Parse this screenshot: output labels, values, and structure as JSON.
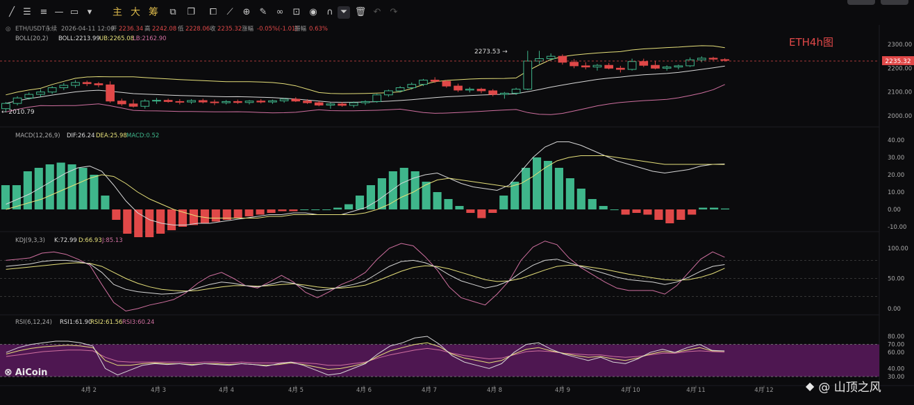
{
  "toolbar": {
    "icons": [
      "trendline-icon",
      "parallel-lines-icon",
      "horizontal-lines-icon",
      "horizontal-line-icon",
      "rectangle-icon"
    ],
    "labels": [
      "主",
      "大",
      "筹"
    ],
    "icons2": [
      "crop-icon",
      "copy-icon",
      "search-plus-icon",
      "ruler-icon",
      "magic-icon",
      "link-icon",
      "lock-icon",
      "magnet-icon",
      "filter-icon",
      "trash-icon",
      "undo-icon",
      "redo-icon"
    ]
  },
  "main_header": {
    "symbol": "ETH/USDT永续",
    "datetime": "2026-04-11 12:00",
    "open_label": "开",
    "open": "2236.34",
    "high_label": "高",
    "high": "2242.08",
    "low_label": "低",
    "low": "2228.06",
    "close_label": "收",
    "close": "2235.32",
    "change_label": "涨幅",
    "change": "-0.05%(-1.01)",
    "amp_label": "振幅",
    "amp": "0.63%"
  },
  "boll_header": {
    "name": "BOLL(20,2)",
    "boll": "BOLL:2213.99",
    "ub": "UB:2265.08",
    "lb": "LB:2162.90"
  },
  "macd_header": {
    "name": "MACD(12,26,9)",
    "dif": "DIF:26.24",
    "dea": "DEA:25.98",
    "macd": "MACD:0.52"
  },
  "kdj_header": {
    "name": "KDJ(9,3,3)",
    "k": "K:72.99",
    "d": "D:66.93",
    "j": "J:85.13"
  },
  "rsi_header": {
    "name": "RSI(6,12,24)",
    "r1": "RSI1:61.90",
    "r2": "RSI2:61.56",
    "r3": "RSI3:60.24"
  },
  "chart_label": "ETH4h图",
  "price_marks": {
    "high_mark": "2273.53",
    "low_mark": "2010.79",
    "last_price": "2235.32"
  },
  "branding": {
    "aicoin": "AiCoin",
    "watermark": "@ 山顶之风"
  },
  "colors": {
    "up": "#3fb68b",
    "down": "#e04848",
    "boll_mid": "#d8d8d8",
    "boll_up": "#e6e07a",
    "boll_low": "#d070a0",
    "rsi_band": "#5a1a5e"
  },
  "chart_data": {
    "type": "candlestick",
    "x_axis": {
      "ticks": [
        "4月 2",
        "4月 3",
        "4月 4",
        "4月 5",
        "4月 6",
        "4月 7",
        "4月 8",
        "4月 9",
        "4月 10",
        "4月 11",
        "4月 12"
      ]
    },
    "price_axis": {
      "ticks": [
        2300,
        2200,
        2100,
        2000
      ],
      "labels": [
        "2300.00",
        "2200.00",
        "2100.00",
        "2000.00"
      ]
    },
    "candles": [
      [
        2030,
        2058,
        2015,
        2052
      ],
      [
        2052,
        2082,
        2044,
        2075
      ],
      [
        2075,
        2098,
        2068,
        2090
      ],
      [
        2090,
        2112,
        2080,
        2100
      ],
      [
        2100,
        2125,
        2092,
        2118
      ],
      [
        2118,
        2138,
        2108,
        2128
      ],
      [
        2128,
        2150,
        2118,
        2140
      ],
      [
        2140,
        2148,
        2125,
        2135
      ],
      [
        2135,
        2142,
        2120,
        2130
      ],
      [
        2130,
        2145,
        2055,
        2062
      ],
      [
        2062,
        2072,
        2042,
        2050
      ],
      [
        2050,
        2068,
        2035,
        2040
      ],
      [
        2040,
        2070,
        2030,
        2062
      ],
      [
        2062,
        2075,
        2050,
        2065
      ],
      [
        2065,
        2072,
        2055,
        2060
      ],
      [
        2060,
        2070,
        2048,
        2058
      ],
      [
        2058,
        2070,
        2050,
        2064
      ],
      [
        2064,
        2072,
        2052,
        2058
      ],
      [
        2058,
        2068,
        2045,
        2055
      ],
      [
        2055,
        2066,
        2048,
        2060
      ],
      [
        2060,
        2068,
        2050,
        2056
      ],
      [
        2056,
        2066,
        2048,
        2062
      ],
      [
        2062,
        2070,
        2052,
        2058
      ],
      [
        2058,
        2068,
        2050,
        2063
      ],
      [
        2063,
        2075,
        2055,
        2070
      ],
      [
        2070,
        2078,
        2058,
        2062
      ],
      [
        2062,
        2070,
        2050,
        2055
      ],
      [
        2055,
        2062,
        2040,
        2045
      ],
      [
        2045,
        2055,
        2030,
        2050
      ],
      [
        2050,
        2058,
        2038,
        2044
      ],
      [
        2044,
        2060,
        2035,
        2055
      ],
      [
        2055,
        2065,
        2045,
        2060
      ],
      [
        2060,
        2092,
        2055,
        2088
      ],
      [
        2088,
        2110,
        2080,
        2105
      ],
      [
        2105,
        2125,
        2098,
        2118
      ],
      [
        2118,
        2140,
        2110,
        2132
      ],
      [
        2132,
        2155,
        2125,
        2150
      ],
      [
        2150,
        2162,
        2138,
        2145
      ],
      [
        2145,
        2150,
        2118,
        2125
      ],
      [
        2125,
        2135,
        2100,
        2108
      ],
      [
        2108,
        2120,
        2098,
        2112
      ],
      [
        2112,
        2118,
        2095,
        2105
      ],
      [
        2105,
        2112,
        2082,
        2090
      ],
      [
        2090,
        2100,
        2072,
        2095
      ],
      [
        2095,
        2118,
        2088,
        2112
      ],
      [
        2112,
        2273,
        2108,
        2230
      ],
      [
        2230,
        2273,
        2218,
        2240
      ],
      [
        2240,
        2262,
        2230,
        2250
      ],
      [
        2250,
        2258,
        2215,
        2225
      ],
      [
        2225,
        2238,
        2200,
        2210
      ],
      [
        2210,
        2225,
        2195,
        2205
      ],
      [
        2205,
        2218,
        2190,
        2212
      ],
      [
        2212,
        2222,
        2195,
        2200
      ],
      [
        2200,
        2210,
        2182,
        2195
      ],
      [
        2195,
        2240,
        2190,
        2228
      ],
      [
        2228,
        2240,
        2205,
        2212
      ],
      [
        2212,
        2230,
        2195,
        2200
      ],
      [
        2200,
        2212,
        2190,
        2205
      ],
      [
        2205,
        2215,
        2195,
        2210
      ],
      [
        2210,
        2245,
        2205,
        2235
      ],
      [
        2235,
        2250,
        2225,
        2242
      ],
      [
        2242,
        2248,
        2232,
        2238
      ],
      [
        2236,
        2242,
        2228,
        2235
      ]
    ],
    "boll": {
      "mid_last": 2213.99,
      "ub_last": 2265.08,
      "lb_last": 2162.9
    },
    "macd_axis": {
      "ticks": [
        40,
        30,
        20,
        10,
        0,
        -10
      ],
      "labels": [
        "40.00",
        "30.00",
        "20.00",
        "10.00",
        "0.00",
        "-10.00"
      ]
    },
    "macd_hist": [
      14,
      14,
      22,
      24,
      26,
      27,
      26,
      24,
      20,
      8,
      -6,
      -14,
      -16,
      -16,
      -14,
      -12,
      -10,
      -9,
      -8,
      -7,
      -6,
      -5,
      -4,
      -3,
      -2,
      -1,
      -1,
      0,
      0,
      0,
      1,
      3,
      8,
      14,
      18,
      22,
      24,
      22,
      16,
      10,
      6,
      2,
      -2,
      -5,
      -2,
      8,
      16,
      24,
      30,
      28,
      24,
      18,
      12,
      6,
      2,
      0,
      -3,
      -2,
      -3,
      -6,
      -8,
      -6,
      -3,
      1,
      1,
      0.52
    ],
    "macd_dif": [
      3,
      6,
      9,
      13,
      17,
      21,
      24,
      25,
      22,
      14,
      5,
      -2,
      -6,
      -8,
      -9,
      -9,
      -8,
      -8,
      -7,
      -6,
      -5,
      -4,
      -3,
      -3,
      -2,
      -2,
      -3,
      -3,
      -3,
      -1,
      1,
      5,
      10,
      15,
      18,
      20,
      21,
      18,
      15,
      13,
      12,
      11,
      14,
      22,
      30,
      36,
      39,
      39,
      37,
      34,
      31,
      28,
      26,
      24,
      22,
      21,
      22,
      23,
      25,
      26,
      26.24
    ],
    "macd_dea": [
      0,
      2,
      4,
      6,
      9,
      12,
      15,
      18,
      20,
      19,
      15,
      10,
      6,
      3,
      0,
      -2,
      -4,
      -5,
      -5,
      -5,
      -5,
      -5,
      -4,
      -4,
      -3,
      -3,
      -3,
      -3,
      -3,
      -3,
      -2,
      0,
      3,
      7,
      10,
      14,
      17,
      18,
      17,
      16,
      15,
      14,
      13,
      15,
      19,
      24,
      28,
      30,
      31,
      31,
      31,
      30,
      29,
      28,
      27,
      26,
      26,
      26,
      26,
      26,
      25.98
    ],
    "kdj_axis": {
      "ticks": [
        100,
        50,
        0
      ],
      "labels": [
        "100.00",
        "50.00",
        "0.00"
      ]
    },
    "kdj_k": [
      70,
      72,
      74,
      78,
      80,
      80,
      78,
      74,
      60,
      40,
      32,
      28,
      26,
      24,
      25,
      28,
      34,
      40,
      44,
      42,
      38,
      36,
      40,
      45,
      42,
      35,
      30,
      32,
      36,
      40,
      46,
      58,
      70,
      78,
      80,
      76,
      68,
      56,
      46,
      40,
      34,
      38,
      46,
      60,
      72,
      80,
      82,
      76,
      70,
      64,
      58,
      52,
      48,
      46,
      44,
      40,
      44,
      52,
      62,
      70,
      72.99
    ],
    "kdj_d": [
      65,
      67,
      69,
      71,
      73,
      75,
      76,
      75,
      70,
      60,
      50,
      42,
      36,
      32,
      30,
      29,
      30,
      33,
      36,
      38,
      38,
      37,
      38,
      40,
      41,
      39,
      36,
      34,
      34,
      36,
      39,
      46,
      54,
      62,
      68,
      71,
      70,
      66,
      60,
      54,
      48,
      45,
      46,
      50,
      57,
      64,
      70,
      72,
      71,
      68,
      65,
      61,
      57,
      54,
      51,
      48,
      47,
      48,
      52,
      58,
      66.93
    ],
    "kdj_j": [
      80,
      82,
      84,
      92,
      94,
      90,
      82,
      72,
      40,
      10,
      -4,
      0,
      6,
      10,
      15,
      26,
      42,
      54,
      60,
      50,
      38,
      34,
      44,
      55,
      44,
      27,
      18,
      28,
      40,
      48,
      60,
      82,
      100,
      108,
      104,
      86,
      64,
      36,
      18,
      12,
      6,
      24,
      46,
      80,
      102,
      112,
      106,
      84,
      68,
      56,
      44,
      34,
      30,
      30,
      30,
      24,
      38,
      60,
      82,
      94,
      85.13
    ],
    "rsi_axis": {
      "ticks": [
        80,
        70,
        60,
        40,
        30
      ],
      "labels": [
        "80.00",
        "70.00",
        "60.00",
        "40.00",
        "30.00"
      ]
    },
    "rsi1": [
      60,
      66,
      70,
      72,
      74,
      74,
      72,
      68,
      40,
      32,
      38,
      44,
      46,
      45,
      46,
      44,
      46,
      45,
      44,
      46,
      45,
      43,
      46,
      48,
      44,
      38,
      32,
      34,
      40,
      46,
      58,
      68,
      72,
      78,
      80,
      70,
      56,
      48,
      44,
      40,
      46,
      60,
      70,
      72,
      64,
      58,
      54,
      50,
      54,
      48,
      46,
      52,
      60,
      64,
      60,
      66,
      70,
      62.5,
      61.9
    ],
    "rsi2": [
      58,
      62,
      65,
      67,
      68,
      69,
      68,
      66,
      50,
      44,
      44,
      46,
      47,
      46,
      46,
      45,
      46,
      46,
      45,
      46,
      45,
      44,
      45,
      47,
      45,
      42,
      39,
      40,
      43,
      47,
      55,
      62,
      66,
      70,
      72,
      67,
      58,
      53,
      50,
      47,
      50,
      58,
      64,
      66,
      62,
      59,
      56,
      54,
      55,
      52,
      50,
      53,
      58,
      61,
      60,
      63,
      66,
      62,
      61.56
    ],
    "rsi3": [
      55,
      57,
      59,
      61,
      62,
      63,
      63,
      62,
      54,
      49,
      48,
      48,
      48,
      48,
      48,
      47,
      48,
      48,
      47,
      48,
      47,
      47,
      47,
      48,
      47,
      46,
      44,
      44,
      46,
      48,
      53,
      57,
      60,
      63,
      65,
      63,
      59,
      56,
      54,
      52,
      53,
      57,
      61,
      62,
      61,
      59,
      58,
      57,
      57,
      55,
      54,
      55,
      57,
      59,
      59,
      61,
      62,
      61,
      60.24
    ]
  }
}
